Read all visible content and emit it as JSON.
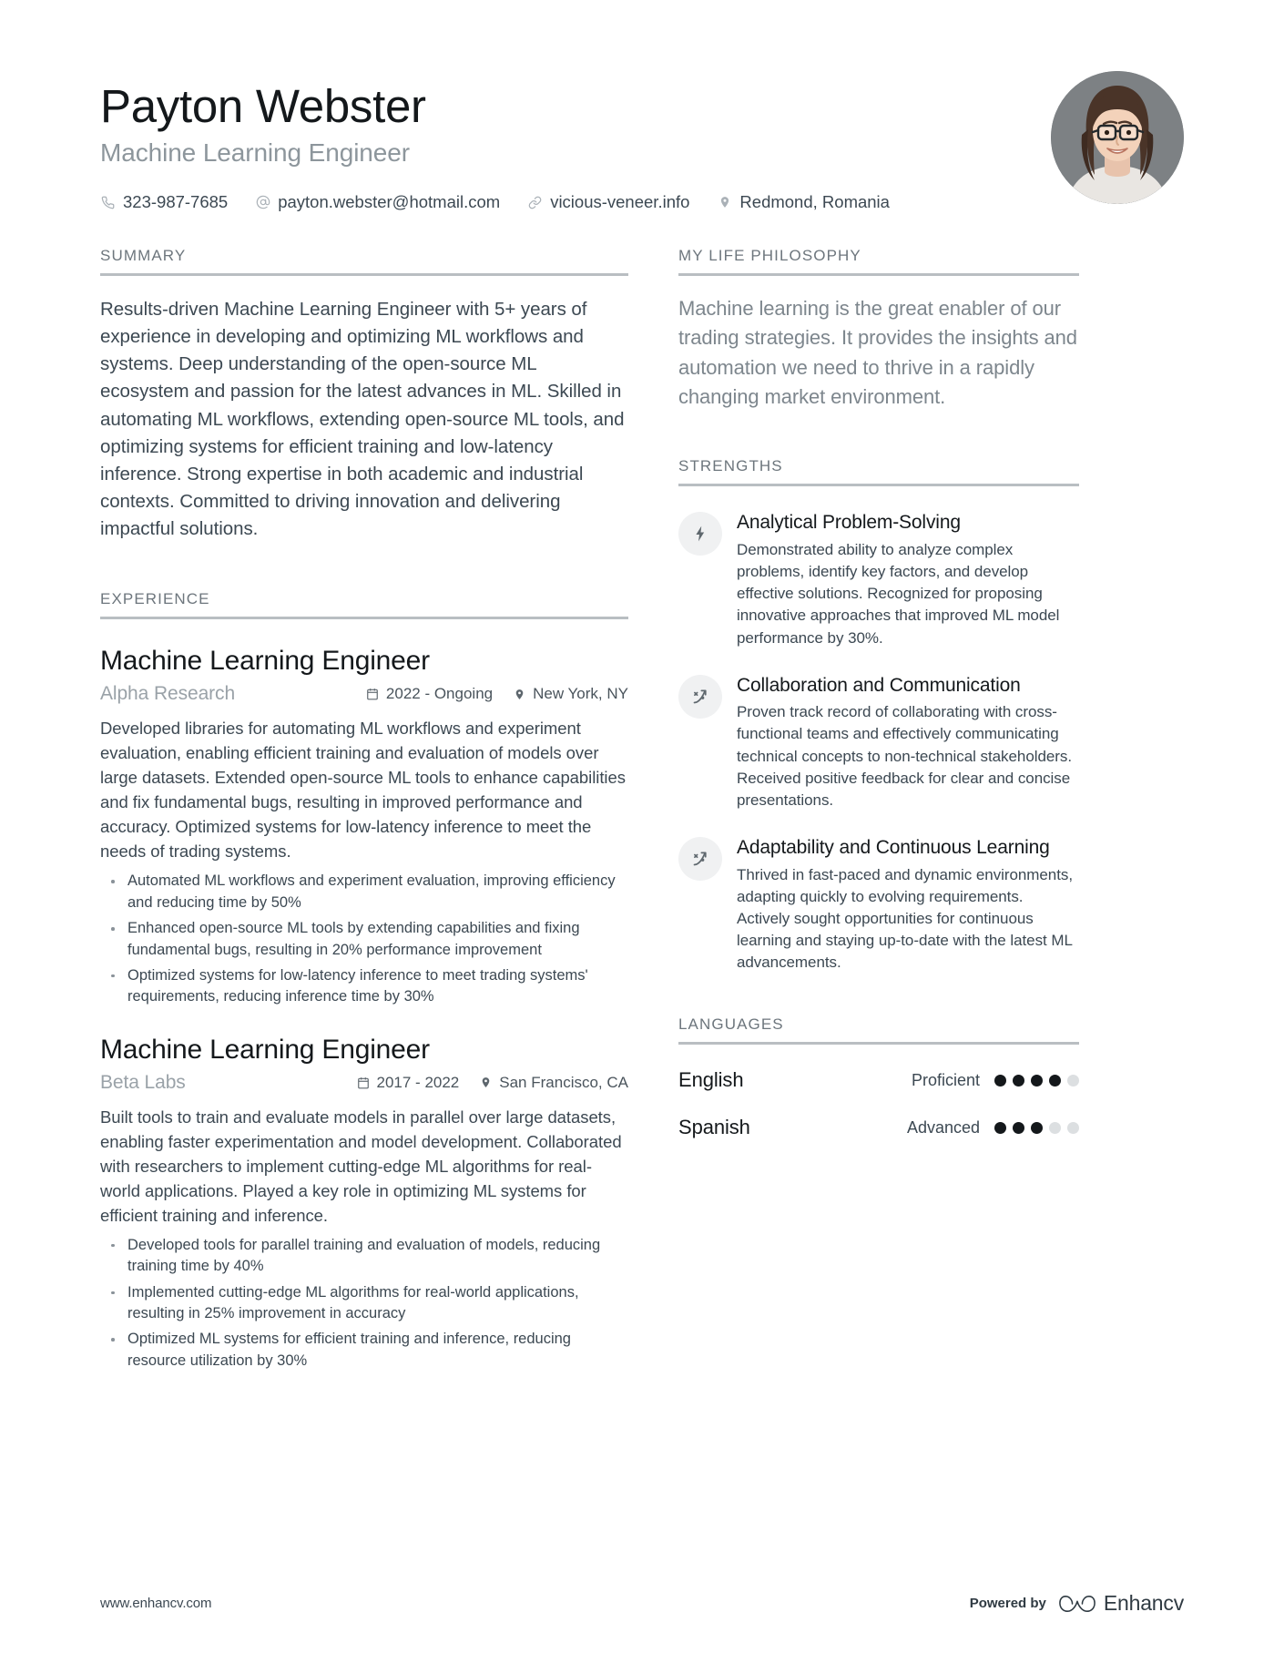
{
  "header": {
    "full_name": "Payton Webster",
    "job_title": "Machine Learning Engineer",
    "contacts": [
      {
        "icon": "phone-icon",
        "value": "323-987-7685"
      },
      {
        "icon": "at-sign-icon",
        "value": "payton.webster@hotmail.com"
      },
      {
        "icon": "link-icon",
        "value": "vicious-veneer.info"
      },
      {
        "icon": "map-pin-icon",
        "value": "Redmond, Romania"
      }
    ],
    "avatar_alt": "profile-photo"
  },
  "summary": {
    "heading": "SUMMARY",
    "text": "Results-driven Machine Learning Engineer with 5+ years of experience in developing and optimizing ML workflows and systems. Deep understanding of the open-source ML ecosystem and passion for the latest advances in ML. Skilled in automating ML workflows, extending open-source ML tools, and optimizing systems for efficient training and low-latency inference. Strong expertise in both academic and industrial contexts. Committed to driving innovation and delivering impactful solutions."
  },
  "experience": {
    "heading": "EXPERIENCE",
    "items": [
      {
        "role": "Machine Learning Engineer",
        "company": "Alpha Research",
        "dates": "2022 - Ongoing",
        "location": "New York, NY",
        "description": "Developed libraries for automating ML workflows and experiment evaluation, enabling efficient training and evaluation of models over large datasets. Extended open-source ML tools to enhance capabilities and fix fundamental bugs, resulting in improved performance and accuracy. Optimized systems for low-latency inference to meet the needs of trading systems.",
        "bullets": [
          "Automated ML workflows and experiment evaluation, improving efficiency and reducing time by 50%",
          "Enhanced open-source ML tools by extending capabilities and fixing fundamental bugs, resulting in 20% performance improvement",
          "Optimized systems for low-latency inference to meet trading systems' requirements, reducing inference time by 30%"
        ]
      },
      {
        "role": "Machine Learning Engineer",
        "company": "Beta Labs",
        "dates": "2017 - 2022",
        "location": "San Francisco, CA",
        "description": "Built tools to train and evaluate models in parallel over large datasets, enabling faster experimentation and model development. Collaborated with researchers to implement cutting-edge ML algorithms for real-world applications. Played a key role in optimizing ML systems for efficient training and inference.",
        "bullets": [
          "Developed tools for parallel training and evaluation of models, reducing training time by 40%",
          "Implemented cutting-edge ML algorithms for real-world applications, resulting in 25% improvement in accuracy",
          "Optimized ML systems for efficient training and inference, reducing resource utilization by 30%"
        ]
      }
    ]
  },
  "philosophy": {
    "heading": "MY LIFE PHILOSOPHY",
    "text": "Machine learning is the great enabler of our trading strategies. It provides the insights and automation we need to thrive in a rapidly changing market environment."
  },
  "strengths": {
    "heading": "STRENGTHS",
    "items": [
      {
        "icon": "lightning-bolt-icon",
        "title": "Analytical Problem-Solving",
        "description": "Demonstrated ability to analyze complex problems, identify key factors, and develop effective solutions. Recognized for proposing innovative approaches that improved ML model performance by 30%."
      },
      {
        "icon": "strategy-arrow-icon",
        "title": "Collaboration and Communication",
        "description": "Proven track record of collaborating with cross-functional teams and effectively communicating technical concepts to non-technical stakeholders. Received positive feedback for clear and concise presentations."
      },
      {
        "icon": "strategy-arrow-icon",
        "title": "Adaptability and Continuous Learning",
        "description": "Thrived in fast-paced and dynamic environments, adapting quickly to evolving requirements. Actively sought opportunities for continuous learning and staying up-to-date with the latest ML advancements."
      }
    ]
  },
  "languages": {
    "heading": "LANGUAGES",
    "total_dots": 5,
    "items": [
      {
        "name": "English",
        "level": "Proficient",
        "filled": 4
      },
      {
        "name": "Spanish",
        "level": "Advanced",
        "filled": 3
      }
    ]
  },
  "footer": {
    "url": "www.enhancv.com",
    "powered_by": "Powered by",
    "brand": "Enhancv"
  },
  "colors": {
    "text_dark": "#14181b",
    "text_body": "#3c4852",
    "text_muted": "#8d969c",
    "rule": "#b9bec2",
    "icon_bg": "#f0f1f2",
    "dot_on": "#14181b",
    "dot_off": "#dcdfe1"
  }
}
